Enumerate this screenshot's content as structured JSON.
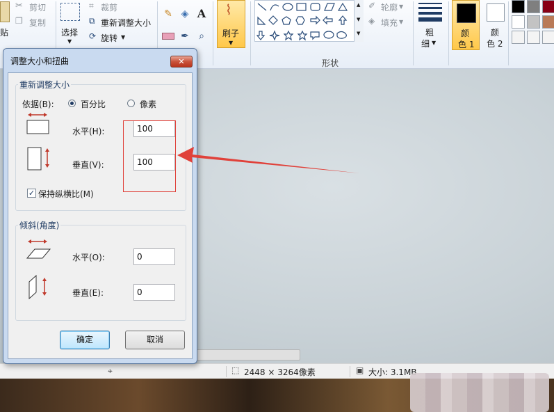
{
  "ribbon": {
    "clipboard": {
      "paste_label": "贴",
      "cut_label": "剪切",
      "copy_label": "复制"
    },
    "image": {
      "select_label": "选择",
      "crop_label": "裁剪",
      "resize_label": "重新调整大小",
      "rotate_label": "旋转"
    },
    "tools": {
      "text_glyph": "A"
    },
    "brushes": {
      "label": "刷子"
    },
    "shapes": {
      "outline_label": "轮廓",
      "fill_label": "填充",
      "group_label": "形状"
    },
    "size": {
      "label_line1": "粗",
      "label_line2": "细"
    },
    "colors": {
      "color1_line1": "颜",
      "color1_line2": "色 1",
      "color2_line1": "颜",
      "color2_line2": "色 2",
      "color1_value": "#000000",
      "color2_value": "#ffffff",
      "palette": [
        "#000000",
        "#7f7f7f",
        "#880015",
        "#ffffff",
        "#c3c3c3",
        "#b97a57"
      ]
    }
  },
  "dialog": {
    "title": "调整大小和扭曲",
    "close_glyph": "✕",
    "resize_group": {
      "title": "重新调整大小",
      "by_label": "依据(B):",
      "percent_label": "百分比",
      "pixels_label": "像素",
      "selected_mode": "percent",
      "horizontal_label": "水平(H):",
      "horizontal_value": "100",
      "vertical_label": "垂直(V):",
      "vertical_value": "100",
      "keep_ratio_label": "保持纵横比(M)",
      "keep_ratio_checked": true
    },
    "skew_group": {
      "title": "倾斜(角度)",
      "horizontal_label": "水平(O):",
      "horizontal_value": "0",
      "vertical_label": "垂直(E):",
      "vertical_value": "0"
    },
    "ok_label": "确定",
    "cancel_label": "取消"
  },
  "statusbar": {
    "dimensions": "2448 × 3264像素",
    "size": "大小: 3.1MB"
  },
  "annotation_color": "#e0413a"
}
